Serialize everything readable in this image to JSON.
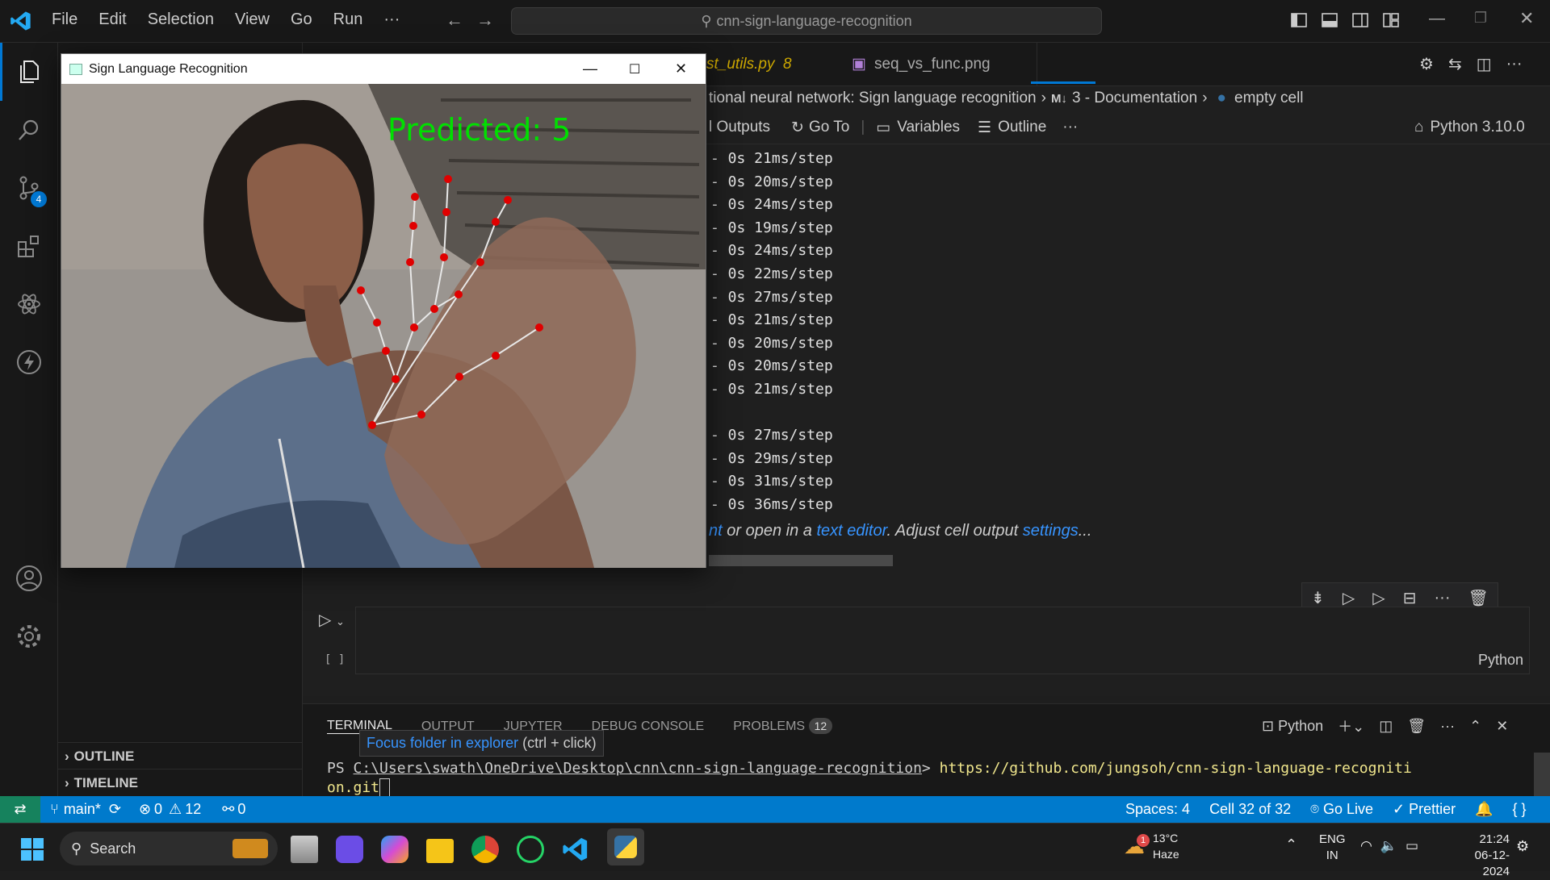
{
  "titlebar": {
    "menus": [
      "File",
      "Edit",
      "Selection",
      "View",
      "Go",
      "Run",
      "···"
    ],
    "search": "cnn-sign-language-recognition"
  },
  "activity": {
    "scm_badge": "4"
  },
  "sidebar": {
    "outline": "OUTLINE",
    "timeline": "TIMELINE"
  },
  "tabs": [
    {
      "label": "st_utils.py",
      "badge": "8"
    },
    {
      "label": "seq_vs_func.png"
    }
  ],
  "breadcrumb": {
    "part1": "tional neural network: Sign language recognition",
    "part2": "3 - Documentation",
    "part3": "empty cell",
    "md": "M↓"
  },
  "toolbar": {
    "outputs": "l Outputs",
    "goto": "Go To",
    "variables": "Variables",
    "outline": "Outline",
    "kernel": "Python 3.10.0"
  },
  "output_lines": [
    "- 0s 21ms/step",
    "- 0s 20ms/step",
    "- 0s 24ms/step",
    "- 0s 19ms/step",
    "- 0s 24ms/step",
    "- 0s 22ms/step",
    "- 0s 27ms/step",
    "- 0s 21ms/step",
    "- 0s 20ms/step",
    "- 0s 20ms/step",
    "- 0s 21ms/step",
    "",
    "- 0s 27ms/step",
    "- 0s 29ms/step",
    "- 0s 31ms/step",
    "- 0s 36ms/step"
  ],
  "truncated": {
    "link1": "nt",
    "t1": " or open in a ",
    "link2": "text editor",
    "t2": ". Adjust cell output ",
    "link3": "settings",
    "t3": "..."
  },
  "cell": {
    "brackets": "[ ]",
    "language": "Python"
  },
  "panel": {
    "tabs": [
      "TERMINAL",
      "OUTPUT",
      "JUPYTER",
      "DEBUG CONSOLE",
      "PROBLEMS"
    ],
    "problems_count": "12",
    "shell": "Python",
    "tooltip_link": "Focus folder in explorer",
    "tooltip_hint": " (ctrl + click)",
    "ps": "PS ",
    "path": "C:\\Users\\swath\\OneDrive\\Desktop\\cnn\\cnn-sign-language-recognition",
    "prompt": "> ",
    "cmd1": "https://github.com/jungsoh/cnn-sign-language-recogniti",
    "cmd2": "on.git"
  },
  "status": {
    "branch": "main*",
    "errors": "0",
    "warnings": "12",
    "ports": "0",
    "spaces": "Spaces: 4",
    "cell": "Cell 32 of 32",
    "golive": "Go Live",
    "prettier": "Prettier"
  },
  "cvwin": {
    "title": "Sign Language Recognition",
    "prediction": "Predicted: 5"
  },
  "taskbar": {
    "search": "Search",
    "weather_temp": "13°C",
    "weather_desc": "Haze",
    "weather_badge": "1",
    "lang1": "ENG",
    "lang2": "IN",
    "time": "21:24",
    "date": "06-12-2024"
  },
  "colors": {
    "accent": "#007acc",
    "predict": "#00e000",
    "landmark": "#e00000"
  }
}
